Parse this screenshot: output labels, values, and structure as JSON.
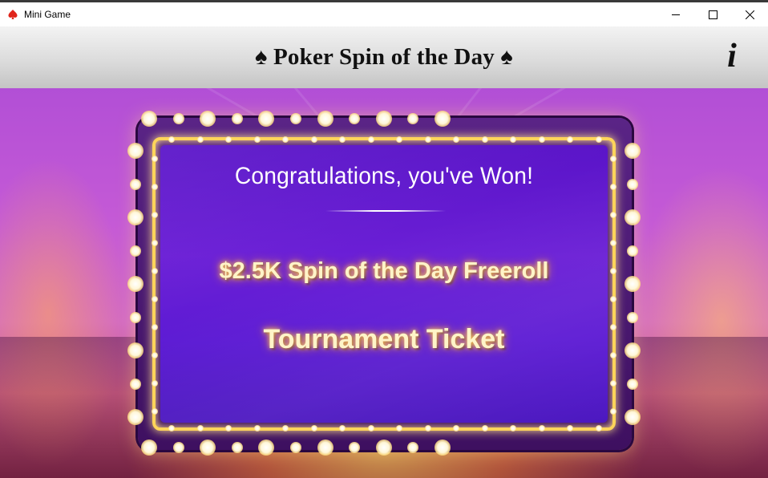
{
  "window": {
    "title": "Mini Game",
    "controls": {
      "minimize": "—",
      "maximize": "☐",
      "close": "✕"
    }
  },
  "header": {
    "title": "♠ Poker Spin of the Day ♠",
    "info_label": "i"
  },
  "prize": {
    "congrats_text": "Congratulations, you've Won!",
    "line1": "$2.5K Spin of the Day Freeroll",
    "line2": "Tournament Ticket"
  },
  "colors": {
    "frame_gold": "#ffd45a",
    "panel_purple": "#5d1bd4",
    "prize_text": "#fff4c8"
  },
  "icons": [
    "app-spade-icon",
    "minimize-icon",
    "maximize-icon",
    "close-icon",
    "info-icon"
  ]
}
